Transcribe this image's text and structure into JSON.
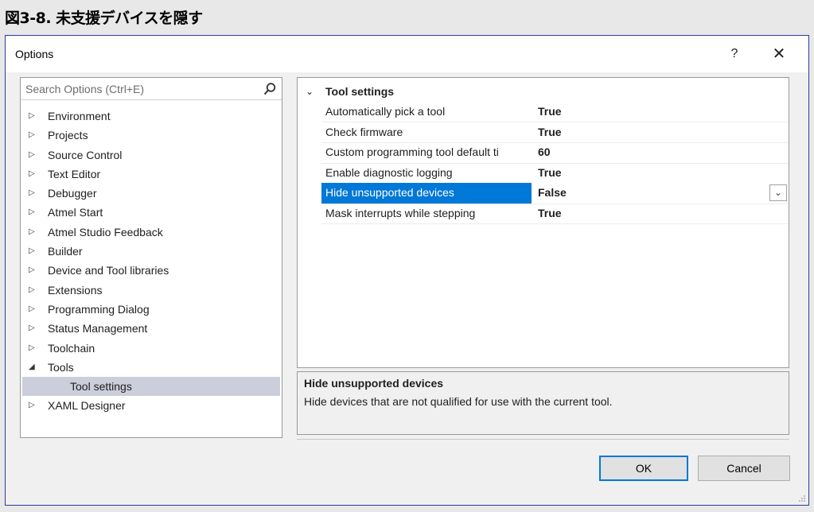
{
  "caption": "図3-8. 未支援デバイスを隠す",
  "dialog": {
    "title": "Options",
    "help_label": "?",
    "close_label": "✕"
  },
  "search": {
    "placeholder": "Search Options (Ctrl+E)",
    "icon": "search-icon"
  },
  "tree": [
    {
      "label": "Environment",
      "arrow": "▷"
    },
    {
      "label": "Projects",
      "arrow": "▷"
    },
    {
      "label": "Source Control",
      "arrow": "▷"
    },
    {
      "label": "Text Editor",
      "arrow": "▷"
    },
    {
      "label": "Debugger",
      "arrow": "▷"
    },
    {
      "label": "Atmel Start",
      "arrow": "▷"
    },
    {
      "label": "Atmel Studio Feedback",
      "arrow": "▷"
    },
    {
      "label": "Builder",
      "arrow": "▷"
    },
    {
      "label": "Device and Tool libraries",
      "arrow": "▷"
    },
    {
      "label": "Extensions",
      "arrow": "▷"
    },
    {
      "label": "Programming Dialog",
      "arrow": "▷"
    },
    {
      "label": "Status Management",
      "arrow": "▷"
    },
    {
      "label": "Toolchain",
      "arrow": "▷"
    },
    {
      "label": "Tools",
      "arrow": "◢"
    },
    {
      "label": "Tool settings",
      "arrow": ""
    },
    {
      "label": "XAML Designer",
      "arrow": "▷"
    }
  ],
  "grid": {
    "category": "Tool settings",
    "chevron": "⌄",
    "rows": [
      {
        "name": "Automatically pick a tool",
        "value": "True"
      },
      {
        "name": "Check firmware",
        "value": "True"
      },
      {
        "name": "Custom programming tool default ti",
        "value": "60"
      },
      {
        "name": "Enable diagnostic logging",
        "value": "True"
      },
      {
        "name": "Hide unsupported devices",
        "value": "False"
      },
      {
        "name": "Mask interrupts while stepping",
        "value": "True"
      }
    ],
    "dropdown_glyph": "⌄"
  },
  "description": {
    "title": "Hide unsupported devices",
    "text": "Hide devices that are not qualified for use with the current tool."
  },
  "buttons": {
    "ok": "OK",
    "cancel": "Cancel"
  },
  "colors": {
    "selection": "#0078d7",
    "tree_selection": "#cccedb",
    "border": "#2b3b9b"
  }
}
